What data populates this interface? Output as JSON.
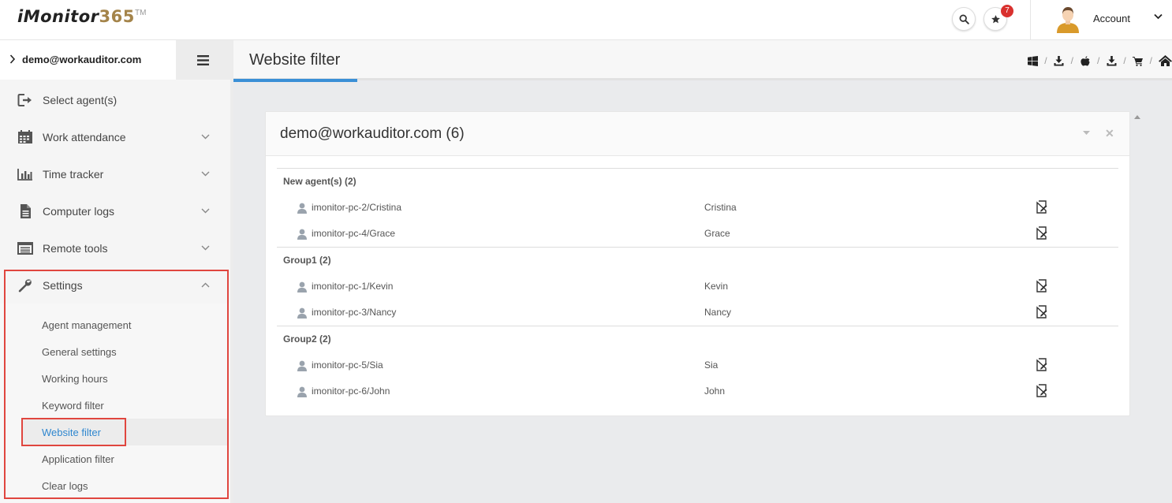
{
  "app": {
    "logo_text": "iMonitor",
    "logo_number": "365",
    "logo_tm": "TM",
    "notification_count": "7",
    "account_label": "Account"
  },
  "sidebar": {
    "user_label": "demo@workauditor.com",
    "menu": [
      {
        "label": "Select agent(s)",
        "icon": "sign-in-icon"
      },
      {
        "label": "Work attendance",
        "icon": "calendar-icon"
      },
      {
        "label": "Time tracker",
        "icon": "bar-chart-icon"
      },
      {
        "label": "Computer logs",
        "icon": "document-icon"
      },
      {
        "label": "Remote tools",
        "icon": "list-window-icon"
      },
      {
        "label": "Settings",
        "icon": "wrench-icon"
      }
    ],
    "settings_items": [
      "Agent management",
      "General settings",
      "Working hours",
      "Keyword filter",
      "Website filter",
      "Application filter",
      "Clear logs"
    ],
    "active_item": "Website filter"
  },
  "page": {
    "title": "Website filter",
    "tools": [
      "windows-icon",
      "download-icon",
      "apple-icon",
      "download-icon",
      "cart-icon",
      "home-icon"
    ]
  },
  "panel": {
    "title": "demo@workauditor.com (6)",
    "groups": [
      {
        "label": "New agent(s) (2)",
        "agents": [
          {
            "name": "imonitor-pc-2/Cristina",
            "alias": "Cristina"
          },
          {
            "name": "imonitor-pc-4/Grace",
            "alias": "Grace"
          }
        ]
      },
      {
        "label": "Group1 (2)",
        "agents": [
          {
            "name": "imonitor-pc-1/Kevin",
            "alias": "Kevin"
          },
          {
            "name": "imonitor-pc-3/Nancy",
            "alias": "Nancy"
          }
        ]
      },
      {
        "label": "Group2 (2)",
        "agents": [
          {
            "name": "imonitor-pc-5/Sia",
            "alias": "Sia"
          },
          {
            "name": "imonitor-pc-6/John",
            "alias": "John"
          }
        ]
      }
    ]
  },
  "colors": {
    "accent": "#3a8fd6",
    "highlight": "#e0463f",
    "badge": "#d9312e",
    "logo_number": "#a4844a"
  }
}
